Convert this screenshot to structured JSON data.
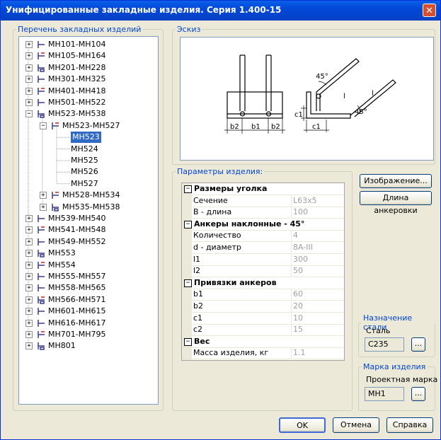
{
  "window": {
    "title": "Унифицированные закладные изделия. Серия 1.400-15",
    "close_glyph": "✕"
  },
  "groups": {
    "tree": "Перечень закладных изделий",
    "sketch": "Эскиз",
    "params": "Параметры изделия:",
    "steel": "Назначение стали",
    "mark": "Марка изделия"
  },
  "tree": {
    "items": [
      {
        "label": "МН101-МН104",
        "expander": "+"
      },
      {
        "label": "МН105-МН164",
        "expander": "+"
      },
      {
        "label": "МН201-МН228",
        "expander": "+"
      },
      {
        "label": "МН301-МН325",
        "expander": "+"
      },
      {
        "label": "МН401-МН418",
        "expander": "+"
      },
      {
        "label": "МН501-МН522",
        "expander": "+"
      },
      {
        "label": "МН523-МН538",
        "expander": "−"
      },
      {
        "label": "МН523-МН527",
        "expander": "−"
      },
      {
        "label": "МН523"
      },
      {
        "label": "МН524"
      },
      {
        "label": "МН525"
      },
      {
        "label": "МН526"
      },
      {
        "label": "МН527"
      },
      {
        "label": "МН528-МН534",
        "expander": "+"
      },
      {
        "label": "МН535-МН538",
        "expander": "+"
      },
      {
        "label": "МН539-МН540",
        "expander": "+"
      },
      {
        "label": "МН541-МН548",
        "expander": "+"
      },
      {
        "label": "МН549-МН552",
        "expander": "+"
      },
      {
        "label": "МН553",
        "expander": "+"
      },
      {
        "label": "МН554",
        "expander": "+"
      },
      {
        "label": "МН555-МН557",
        "expander": "+"
      },
      {
        "label": "МН558-МН565",
        "expander": "+"
      },
      {
        "label": "МН566-МН571",
        "expander": "+"
      },
      {
        "label": "МН601-МН615",
        "expander": "+"
      },
      {
        "label": "МН616-МН617",
        "expander": "+"
      },
      {
        "label": "МН701-МН795",
        "expander": "+"
      },
      {
        "label": "МН801",
        "expander": "+"
      }
    ],
    "selected": "МН523"
  },
  "sketch_labels": {
    "b2l": "b2",
    "b1": "b1",
    "b2r": "b2",
    "c1v": "c1",
    "c1h": "c1",
    "l1": "l",
    "l2": "l",
    "a1": "45°",
    "a2": "45°"
  },
  "params": [
    {
      "type": "cat",
      "label": "Размеры уголка",
      "expander": "−"
    },
    {
      "type": "prop",
      "label": "Сечение",
      "value": "L63x5"
    },
    {
      "type": "prop",
      "label": "В - длина",
      "value": "100"
    },
    {
      "type": "cat",
      "label": "Анкеры наклонные - 45°",
      "expander": "−"
    },
    {
      "type": "prop",
      "label": "Количество",
      "value": "4"
    },
    {
      "type": "prop",
      "label": "d - диаметр",
      "value": "8A-III"
    },
    {
      "type": "prop",
      "label": "l1",
      "value": "300"
    },
    {
      "type": "prop",
      "label": "l2",
      "value": "50"
    },
    {
      "type": "cat",
      "label": "Привязки анкеров",
      "expander": "−"
    },
    {
      "type": "prop",
      "label": "b1",
      "value": "60"
    },
    {
      "type": "prop",
      "label": "b2",
      "value": "20"
    },
    {
      "type": "prop",
      "label": "c1",
      "value": "10"
    },
    {
      "type": "prop",
      "label": "c2",
      "value": "15"
    },
    {
      "type": "cat",
      "label": "Вес",
      "expander": "−"
    },
    {
      "type": "prop",
      "label": "Масса изделия, кг",
      "value": "1.1"
    }
  ],
  "buttons": {
    "image": "Изображение...",
    "anchor": "Длина анкеровки",
    "ok": "OK",
    "cancel": "Отмена",
    "help": "Справка",
    "browse": "..."
  },
  "steel": {
    "label": "Сталь",
    "value": "С235"
  },
  "mark": {
    "label": "Проектная марка",
    "value": "МН1"
  },
  "colors": {
    "title_bar": "#0348d8",
    "group_label": "#0046d5",
    "selection": "#316ac5",
    "icon": "#3a3a8a",
    "icon_accent": "#cc2020"
  }
}
